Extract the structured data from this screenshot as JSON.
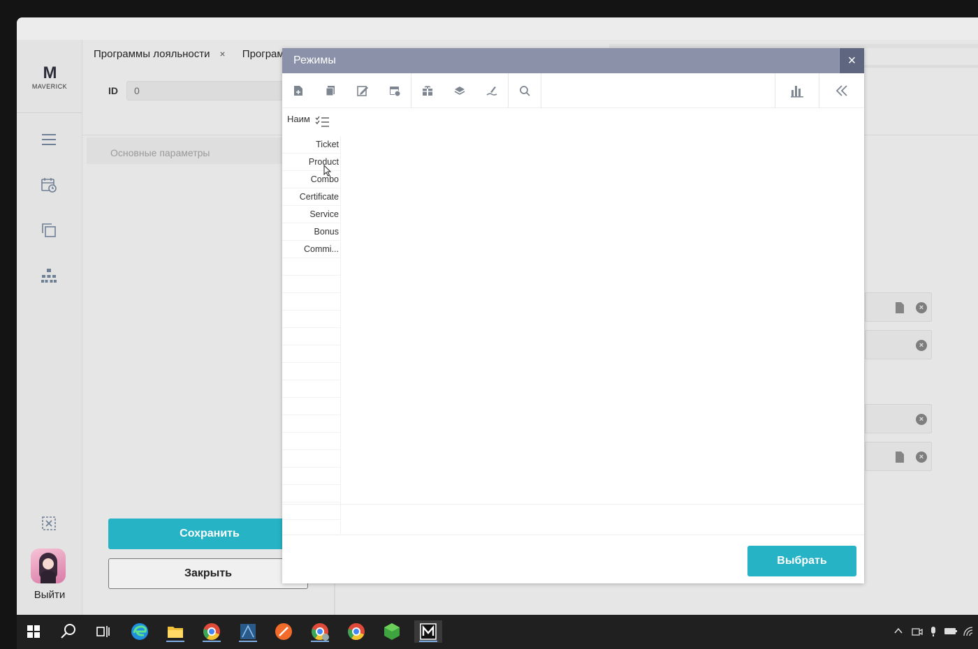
{
  "sidebar": {
    "logo_letter": "M",
    "logo_text": "MAVERICK",
    "items": [
      {
        "name": "menu-icon"
      },
      {
        "name": "calendar-clock-icon"
      },
      {
        "name": "copy-icon"
      },
      {
        "name": "hierarchy-icon"
      },
      {
        "name": "clear-selection-icon"
      }
    ],
    "logout_label": "Выйти"
  },
  "tabs": [
    {
      "label": "Программы лояльности"
    },
    {
      "label": "Программ"
    }
  ],
  "form": {
    "id_label": "ID",
    "id_value": "0",
    "section_title": "Основные параметры",
    "save_label": "Сохранить",
    "close_label": "Закрыть"
  },
  "modal": {
    "title": "Режимы",
    "close_glyph": "×",
    "column_header": "Наим",
    "rows": [
      "Ticket",
      "Product",
      "Combo",
      "Certificate",
      "Service",
      "Bonus",
      "Commi..."
    ],
    "select_label": "Выбрать",
    "toolbar": [
      "add-icon",
      "copy-icon",
      "edit-icon",
      "calendar-settings-icon",
      "gift-icon",
      "layers-icon",
      "pen-sign-icon",
      "search-icon",
      "bar-chart-icon",
      "collapse-icon"
    ]
  },
  "colors": {
    "accent": "#27b3c6",
    "modal_header": "#8a91a8",
    "modal_close": "#5f6780"
  }
}
